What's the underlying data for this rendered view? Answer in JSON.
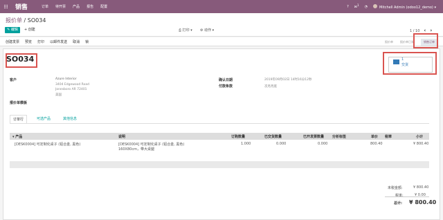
{
  "nav": {
    "brand": "销售",
    "menu": [
      "订单",
      "待开票",
      "产品",
      "报告",
      "配置"
    ],
    "user": "Mitchell Admin (odoo12_demo)",
    "badge": "1"
  },
  "breadcrumb": {
    "parent": "报价单",
    "sep": " / ",
    "current": "SO034"
  },
  "buttons": {
    "edit": "编辑",
    "create": "创建",
    "print": "打印",
    "action": "动作"
  },
  "pager": {
    "text": "1 / 10"
  },
  "statusbar": {
    "buttons": [
      "创建发票",
      "预览",
      "打印",
      "以邮件发送",
      "取消",
      "锁"
    ],
    "states": [
      "报价单",
      "报价单已发",
      "销售订单"
    ],
    "active_state": "销售订单"
  },
  "order": {
    "name": "SO034"
  },
  "smart": {
    "count": "1",
    "label": "交货"
  },
  "customer": {
    "label": "客户",
    "lines": [
      "Azure Interior",
      "3404 Edgewood Road",
      "Jonesboro AR 72401",
      "美国"
    ]
  },
  "confirm": {
    "label": "确认日期",
    "value": "2019年09月02日 14时16分12秒"
  },
  "terms": {
    "label": "付款条款",
    "value": "次月月底"
  },
  "template": {
    "label": "报价单模板"
  },
  "tabs": [
    "订单行",
    "可选产品",
    "其他信息"
  ],
  "table": {
    "headers": [
      "产品",
      "说明",
      "订购数量",
      "已交货数量",
      "已开发票数量",
      "分析标签",
      "单价",
      "税率",
      "小计"
    ],
    "rows": [
      {
        "product": "[DESK0004] 可定制化桌子 (铝合金, 黑色)",
        "desc1": "[DESK0004] 可定制化桌子 (铝合金, 黑色)",
        "desc2": "160X80cm，带大桌腿",
        "qty": "1.000",
        "delivered": "0.000",
        "invoiced": "0.000",
        "price": "800.40",
        "subtotal": "¥ 800.40"
      }
    ]
  },
  "totals": {
    "untaxed_label": "未税金额:",
    "untaxed": "¥ 800.40",
    "tax_label": "税率:",
    "tax": "¥ 0.00",
    "total_label": "总计:",
    "total": "¥ 800.40"
  },
  "colors": {
    "brand": "#875a7b",
    "accent": "#00a09d",
    "highlight": "#d9534f"
  }
}
